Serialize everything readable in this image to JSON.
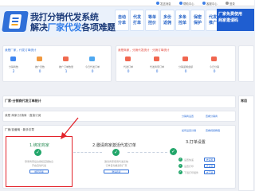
{
  "topbar": {
    "items": [
      "发送消息",
      "帮助中心",
      "客服中心"
    ],
    "login": "登录"
  },
  "banner": {
    "slogan_line1": "我打分销代发系统",
    "slogan_line2_part1": "解决",
    "slogan_line2_highlight": "厂家代发",
    "slogan_line2_part2": "各项难题",
    "features": [
      [
        "自动",
        "分单"
      ],
      [
        "代发",
        "打单"
      ],
      [
        "等单",
        "控价"
      ],
      [
        "多份",
        "返佣"
      ],
      [
        "多条",
        "控单"
      ],
      [
        "保密",
        "保护"
      ],
      [
        "代发",
        "推广"
      ]
    ],
    "promo_line1": "厂家免费使用",
    "promo_line2": "商家邀请码"
  },
  "left_stats": {
    "title": "我是厂家，代发订单统计",
    "items": [
      {
        "label": "分销商数",
        "value": "2",
        "color": "#3f86f0",
        "icon": "distributor-icon"
      },
      {
        "label": "推广员数",
        "value": "0",
        "color": "#f0983f",
        "icon": "promoter-icon"
      },
      {
        "label": "推广订单数量",
        "value": "1",
        "color": "#f06a4f",
        "icon": "order-icon"
      },
      {
        "label": "今日代发订单",
        "value": "0",
        "color": "#4fa8f0",
        "icon": "today-order-icon"
      }
    ]
  },
  "right_stats": {
    "title": "我是商家，分销代发统计 · 分销订单统计",
    "items": [
      {
        "label": "代发订单",
        "value": "0",
        "color": "#f0664f",
        "icon": "proxy-order-icon"
      },
      {
        "label": "代发商家订单",
        "value": "0",
        "color": "#f0664f",
        "icon": "merchant-order-icon"
      },
      {
        "label": "分销返佣金额",
        "value": "0",
        "color": "#f0664f",
        "icon": "commission-icon"
      },
      {
        "label": "今日分销",
        "value": "0",
        "color": "#f0664f",
        "icon": "today-dist-icon"
      }
    ]
  },
  "sections": {
    "orders_title": "厂家-分销商代发订单统计",
    "usage_title": "常用",
    "merchant_row": "我是 商家/分销商 · 直接订阅",
    "merchant_link1": "分销商设置",
    "merchant_link2": "查看分销商",
    "guide_title": "厂家/自营商 · 新手引导",
    "guide_link1": "如何设置分销",
    "guide_link2": "查看视频教程"
  },
  "steps": [
    {
      "title": "1.绑定商家",
      "desc1": "登录商家后台授权店铺信息",
      "desc2": "开启自动代发",
      "button": "绑定店铺"
    },
    {
      "title": "2.邀请商家激活代发订单",
      "desc1": "邀请商家使用代发系统",
      "desc2": "订单自动推送到厂家",
      "button": "邀请商家"
    },
    {
      "title": "3.打单设置",
      "desc1": "设置打印机",
      "desc2": "打印面单",
      "button": "设置"
    }
  ],
  "step3_list": [
    {
      "label": "设置快递",
      "button": "去设置"
    },
    {
      "label": "设置打印",
      "button": "去设置"
    },
    {
      "label": "下载打印组件",
      "button": "去下载"
    }
  ],
  "colors": {
    "brand": "#2f6fd8",
    "highlight_box": "#e3232b",
    "success": "#22a66a"
  }
}
